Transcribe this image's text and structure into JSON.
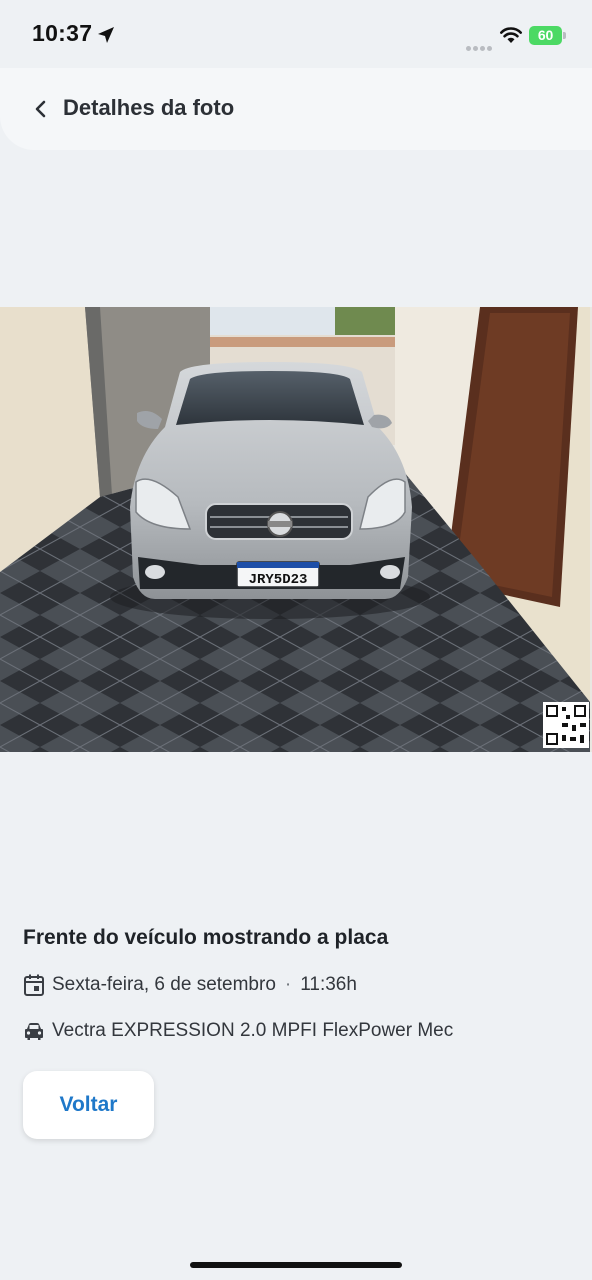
{
  "status_bar": {
    "time": "10:37",
    "battery_level": "60",
    "icons": [
      "location-arrow-icon",
      "cellular-signal-icon",
      "wifi-icon",
      "battery-icon"
    ]
  },
  "header": {
    "back_icon": "chevron-left-icon",
    "title": "Detalhes da foto"
  },
  "photo": {
    "license_plate": "JRY5D23",
    "plate_country": "BRASIL"
  },
  "details": {
    "caption": "Frente do veículo mostrando a placa",
    "date": "Sexta-feira, 6 de setembro",
    "separator": "·",
    "time": "11:36h",
    "date_icon": "calendar-icon",
    "model": "Vectra EXPRESSION 2.0 MPFI FlexPower Mec",
    "model_icon": "car-icon"
  },
  "actions": {
    "back_label": "Voltar"
  },
  "colors": {
    "accent": "#1f78c9",
    "background": "#eef1f4",
    "battery": "#4cd964"
  }
}
